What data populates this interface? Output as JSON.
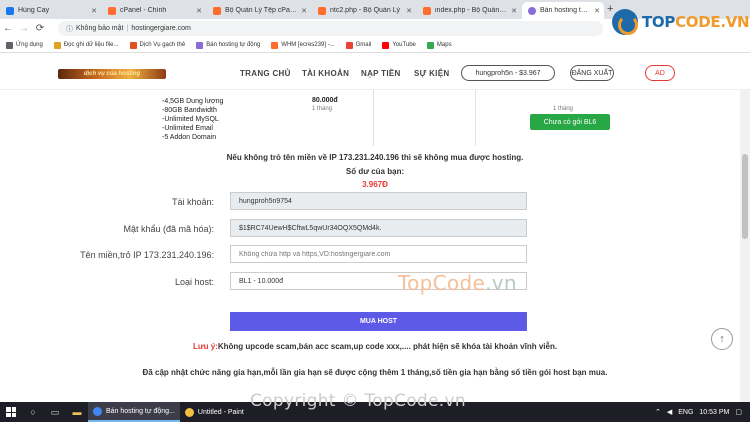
{
  "browser": {
    "tabs": [
      {
        "title": "Hùng Cay",
        "color": "#1877f2"
      },
      {
        "title": "cPanel - Chính",
        "color": "#ff6c2c"
      },
      {
        "title": "Bộ Quản Lý Tệp cPanel",
        "color": "#ff6c2c"
      },
      {
        "title": "ntc2.php - Bộ Quản Lý",
        "color": "#ff6c2c"
      },
      {
        "title": "index.php - Bộ Quản Lý",
        "color": "#ff6c2c"
      },
      {
        "title": "Bán hosting tự động",
        "color": "#8a6cd8"
      }
    ],
    "new_tab": "+",
    "nav": {
      "back": "←",
      "forward": "→",
      "reload": "⟳",
      "home": "⌂"
    },
    "address": {
      "security": "Không bảo mật",
      "url": "hostingergiare.com"
    },
    "bookmarks": [
      {
        "label": "Ứng dụng",
        "color": "#5f6368"
      },
      {
        "label": "Đọc ghi dữ liệu file...",
        "color": "#e0a020"
      },
      {
        "label": "Dịch Vụ gạch thẻ",
        "color": "#e05020"
      },
      {
        "label": "Bán hosting tự động",
        "color": "#8a6cd8"
      },
      {
        "label": "WHM [ecres239] -...",
        "color": "#ff6c2c"
      },
      {
        "label": "Gmail",
        "color": "#ea4335"
      },
      {
        "label": "YouTube",
        "color": "#ff0000"
      },
      {
        "label": "Maps",
        "color": "#34a853"
      }
    ]
  },
  "brand": {
    "name_a": "TOP",
    "name_b": "CODE.VN"
  },
  "site": {
    "logo_text": "dịch vụ của hosting",
    "menu": [
      "TRANG CHỦ",
      "TÀI KHOẢN",
      "NẠP TIỀN",
      "SỰ KIỆN"
    ],
    "user_pill": "hungproh5n - $3.967",
    "logout": "ĐĂNG XUẤT",
    "admin": "AD"
  },
  "plan": {
    "features": [
      "-4,5GB Dung lượng",
      "-80GB Bandwidth",
      "-Unlimited MySQL",
      "-Unlimited Email",
      "-5 Addon Domain"
    ],
    "price": "80.000đ",
    "period": "1 tháng",
    "period_right": "1 tháng",
    "status_button": "Chưa có gói BL6"
  },
  "notice": "Nếu không trỏ tên miền về IP 173.231.240.196 thì sẽ không mua được hosting.",
  "balance": {
    "label": "Số dư của bạn:",
    "value": "3.967Đ"
  },
  "form": {
    "account_label": "Tài khoản:",
    "account_value": "hungproh5n9754",
    "password_label": "Mật khẩu (đã mã hóa):",
    "password_value": "$1$RC74UewH$CftwL5qwUr34OQX5QMd4k.",
    "domain_label": "Tên miền,trỏ IP 173.231.240.196:",
    "domain_placeholder": "Không chứa http và https,VD:hostingergiare.com",
    "host_label": "Loại host:",
    "host_value": "BL1 - 10.000đ",
    "submit": "MUA HOST"
  },
  "warning": {
    "label": "Lưu ý:",
    "text": "Không upcode scam,bán acc scam,up code xxx,.... phát hiện sẽ khóa tài khoản vĩnh viễn."
  },
  "info": "Đã cập nhật chức năng gia hạn,mỗi lần gia hạn sẽ được cộng thêm 1 tháng,số tiền gia hạn bằng số tiền gói host bạn mua.",
  "watermark": {
    "a": "TopCode",
    "b": ".vn"
  },
  "copyright": "Copyright © TopCode.vn",
  "taskbar": {
    "apps": [
      {
        "label": "Bán hosting tự động...",
        "color": "#4285f4",
        "active": true
      },
      {
        "label": "Untitled - Paint",
        "color": "#f0c040",
        "active": false
      }
    ],
    "language": "ENG",
    "time": "10:53 PM"
  }
}
